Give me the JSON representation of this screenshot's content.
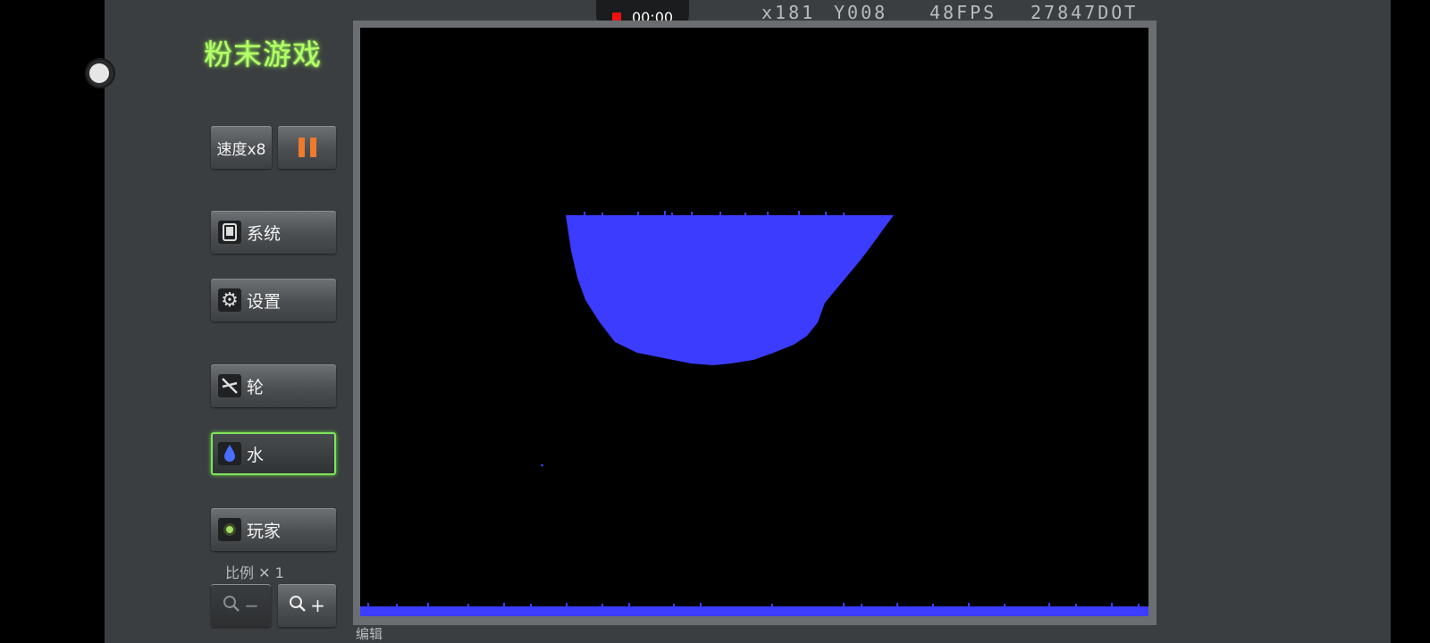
{
  "recording": {
    "time": "00:00"
  },
  "hud": {
    "x": "x181",
    "y": "Y008",
    "fps": "48FPS",
    "dots": "27847DOT"
  },
  "app": {
    "title": "粉末游戏"
  },
  "buttons": {
    "speed": "速度x8",
    "system": "系统",
    "settings": "设置",
    "wheel": "轮",
    "water": "水",
    "player": "玩家"
  },
  "icons": {
    "pause": "pause-icon",
    "system": "tablet-icon",
    "settings": "gear-icon",
    "wheel": "wheel-icon",
    "water": "water-drop-icon",
    "player": "player-icon",
    "zoom_out": "zoom-out-icon",
    "zoom_in": "zoom-in-icon"
  },
  "scale": {
    "label": "比例 ✕ 1"
  },
  "zoom": {
    "minus": "−",
    "plus": "+"
  },
  "mode": {
    "label": "编辑"
  },
  "colors": {
    "water": "#3c3cff",
    "title_glow": "#a8ff60",
    "active_border": "#7fe35a",
    "pause": "#f07a2a"
  }
}
